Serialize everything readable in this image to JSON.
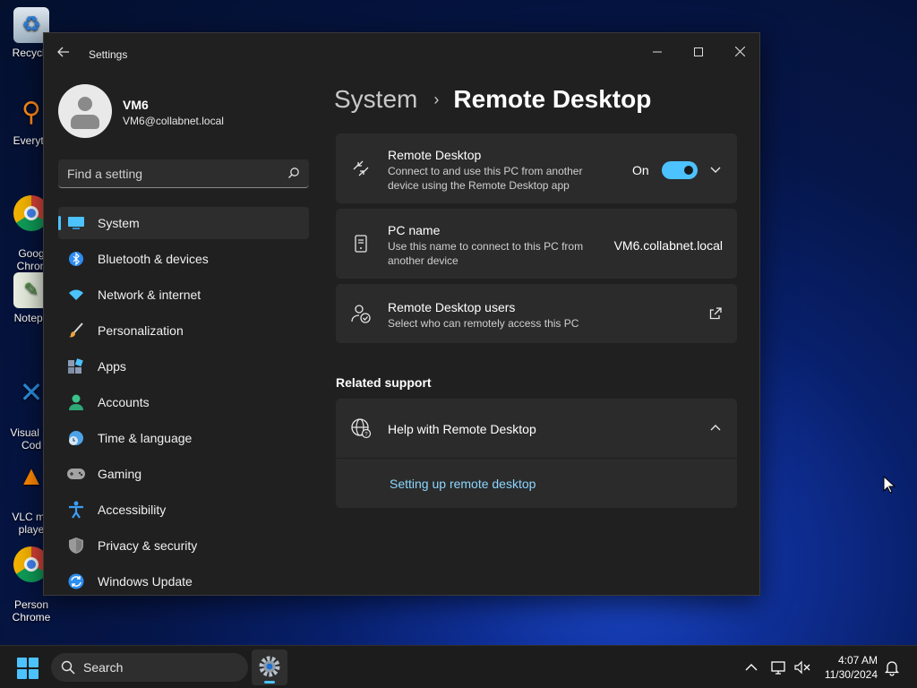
{
  "desktop": {
    "icons": [
      {
        "label": "Recycle",
        "icon": "recycle-bin-icon"
      },
      {
        "label": "Everyth",
        "icon": "everything-search-icon"
      },
      {
        "label": "Goog\nChron",
        "icon": "chrome-icon"
      },
      {
        "label": "Notepa",
        "icon": "notepad-icon"
      },
      {
        "label": "Visual St\nCod",
        "icon": "vscode-icon"
      },
      {
        "label": "VLC me\nplaye",
        "icon": "vlc-icon"
      },
      {
        "label": "Person\nChrome",
        "icon": "chrome-icon"
      }
    ]
  },
  "window": {
    "title": "Settings",
    "controls": {
      "minimize": "—",
      "maximize": "☐",
      "close": "✕"
    }
  },
  "profile": {
    "name": "VM6",
    "email": "VM6@collabnet.local"
  },
  "search": {
    "placeholder": "Find a setting"
  },
  "nav": {
    "items": [
      {
        "label": "System",
        "icon": "system-icon",
        "color": "#4cc2ff",
        "active": true
      },
      {
        "label": "Bluetooth & devices",
        "icon": "bluetooth-icon",
        "color": "#2d8df2"
      },
      {
        "label": "Network & internet",
        "icon": "wifi-icon",
        "color": "#4cc2ff"
      },
      {
        "label": "Personalization",
        "icon": "brush-icon",
        "color": "#e8a33a"
      },
      {
        "label": "Apps",
        "icon": "apps-icon",
        "color": "#7f8ea6"
      },
      {
        "label": "Accounts",
        "icon": "accounts-icon",
        "color": "#3bc38c"
      },
      {
        "label": "Time & language",
        "icon": "globe-clock-icon",
        "color": "#4ca3e8"
      },
      {
        "label": "Gaming",
        "icon": "gamepad-icon",
        "color": "#a3a3a3"
      },
      {
        "label": "Accessibility",
        "icon": "accessibility-icon",
        "color": "#3a9ef5"
      },
      {
        "label": "Privacy & security",
        "icon": "shield-icon",
        "color": "#9a9a9a"
      },
      {
        "label": "Windows Update",
        "icon": "update-icon",
        "color": "#2d8df2"
      }
    ]
  },
  "breadcrumb": {
    "parent": "System",
    "separator": "›",
    "current": "Remote Desktop"
  },
  "remote_desktop": {
    "title": "Remote Desktop",
    "description": "Connect to and use this PC from another device using the Remote Desktop app",
    "toggle_label": "On",
    "toggle_on": true
  },
  "pc_name": {
    "title": "PC name",
    "description": "Use this name to connect to this PC from another device",
    "value": "VM6.collabnet.local"
  },
  "rd_users": {
    "title": "Remote Desktop users",
    "description": "Select who can remotely access this PC"
  },
  "related_support": {
    "heading": "Related support",
    "help_title": "Help with Remote Desktop",
    "link": "Setting up remote desktop"
  },
  "taskbar": {
    "search_label": "Search",
    "time": "4:07 AM",
    "date": "11/30/2024"
  },
  "colors": {
    "accent": "#4cc2ff",
    "card": "#2b2b2b",
    "window": "#202020"
  }
}
